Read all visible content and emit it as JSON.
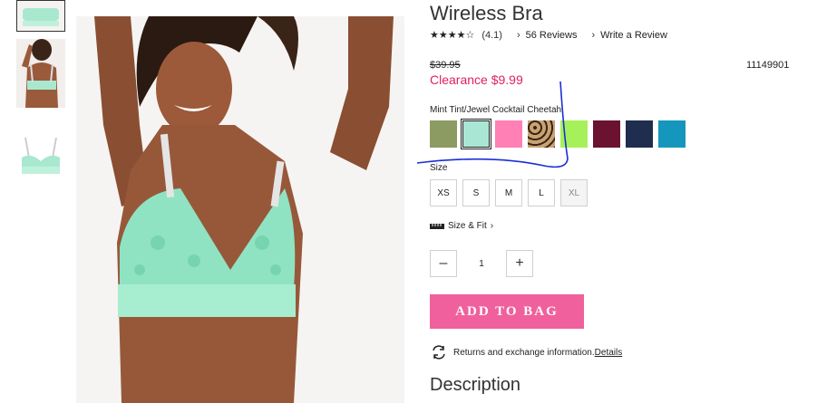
{
  "product": {
    "title": "Wireless Bra",
    "stars": "★★★★☆",
    "rating": "(4.1)",
    "reviews_link": "56 Reviews",
    "write_review_link": "Write a Review",
    "original_price": "$39.95",
    "sale_price": "Clearance $9.99",
    "sku": "11149901",
    "color_label": "Mint Tint/Jewel Cocktail Cheetah",
    "swatches": [
      {
        "name": "olive",
        "color": "#8c9b62"
      },
      {
        "name": "mint",
        "color": "#a9e6d4"
      },
      {
        "name": "pink",
        "color": "#ff80b4"
      },
      {
        "name": "leopard",
        "color": "#b79468"
      },
      {
        "name": "lime",
        "color": "#a6f15a"
      },
      {
        "name": "burgundy",
        "color": "#6b1230"
      },
      {
        "name": "navy",
        "color": "#1f2e4e"
      },
      {
        "name": "teal",
        "color": "#1597bd"
      }
    ],
    "size_label": "Size",
    "sizes": [
      "XS",
      "S",
      "M",
      "L",
      "XL"
    ],
    "size_fit_link": "Size & Fit",
    "quantity": "1",
    "add_to_bag": "ADD TO BAG",
    "returns_text": "Returns and exchange information.",
    "returns_link": "Details",
    "description_heading": "Description"
  },
  "colors": {
    "accent_pink": "#f0609c",
    "sale_red": "#e0215f",
    "annotation_blue": "#1a2ed6"
  }
}
